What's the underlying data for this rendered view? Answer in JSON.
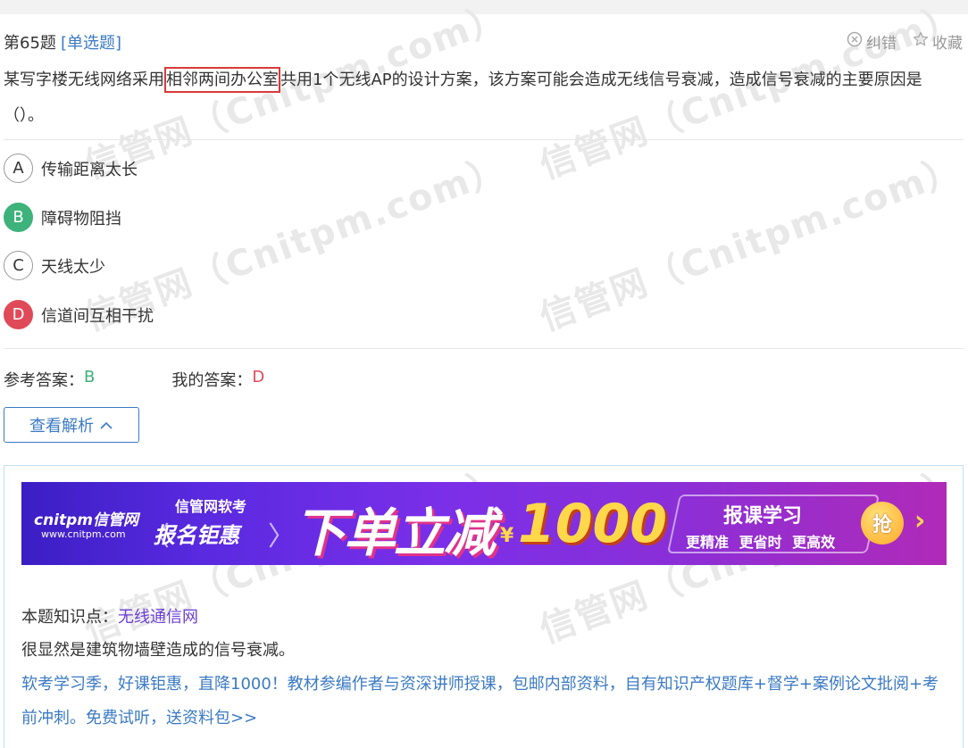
{
  "question": {
    "number_label": "第65题",
    "type_label": "[单选题]",
    "actions": {
      "report_label": "纠错",
      "favorite_label": "收藏"
    },
    "stem_before": "某写字楼无线网络采用",
    "stem_highlight": "相邻两间办公室",
    "stem_after": "共用1个无线AP的设计方案，该方案可能会造成无线信号衰减，造成信号衰减的主要原因是（）。",
    "options": [
      {
        "letter": "A",
        "text": "传输距离太长",
        "state": "none"
      },
      {
        "letter": "B",
        "text": "障碍物阻挡",
        "state": "correct"
      },
      {
        "letter": "C",
        "text": "天线太少",
        "state": "none"
      },
      {
        "letter": "D",
        "text": "信道间互相干扰",
        "state": "wrong"
      }
    ]
  },
  "answers": {
    "reference_label": "参考答案：",
    "reference_value": "B",
    "mine_label": "我的答案：",
    "mine_value": "D"
  },
  "analysis": {
    "toggle_label": "查看解析",
    "banner": {
      "logo": "cnitpm信管网",
      "url": "www.cnitpm.com",
      "sub_title": "信管网软考",
      "sub_main": "报名钜惠",
      "headline": "下单立减",
      "currency": "¥",
      "amount": "1000",
      "right_title": "报课学习",
      "right_sub": "更精准 更省时 更高效",
      "grab": "抢"
    },
    "knowledge_label": "本题知识点：",
    "knowledge_value": "无线通信网",
    "explanation": "很显然是建筑物墙壁造成的信号衰减。",
    "promo": "软考学习季，好课钜惠，直降1000！教材参编作者与资深讲师授课，包邮内部资料，自有知识产权题库+督学+案例论文批阅+考前冲刺。免费试听，送资料包>>"
  },
  "watermark": "信管网（Cnitpm.com）",
  "colors": {
    "accent": "#3b7ac4",
    "correct": "#3db27a",
    "wrong": "#e04a58",
    "highlight_border": "#d93a3a",
    "knowledge_link": "#6a3fd6"
  }
}
